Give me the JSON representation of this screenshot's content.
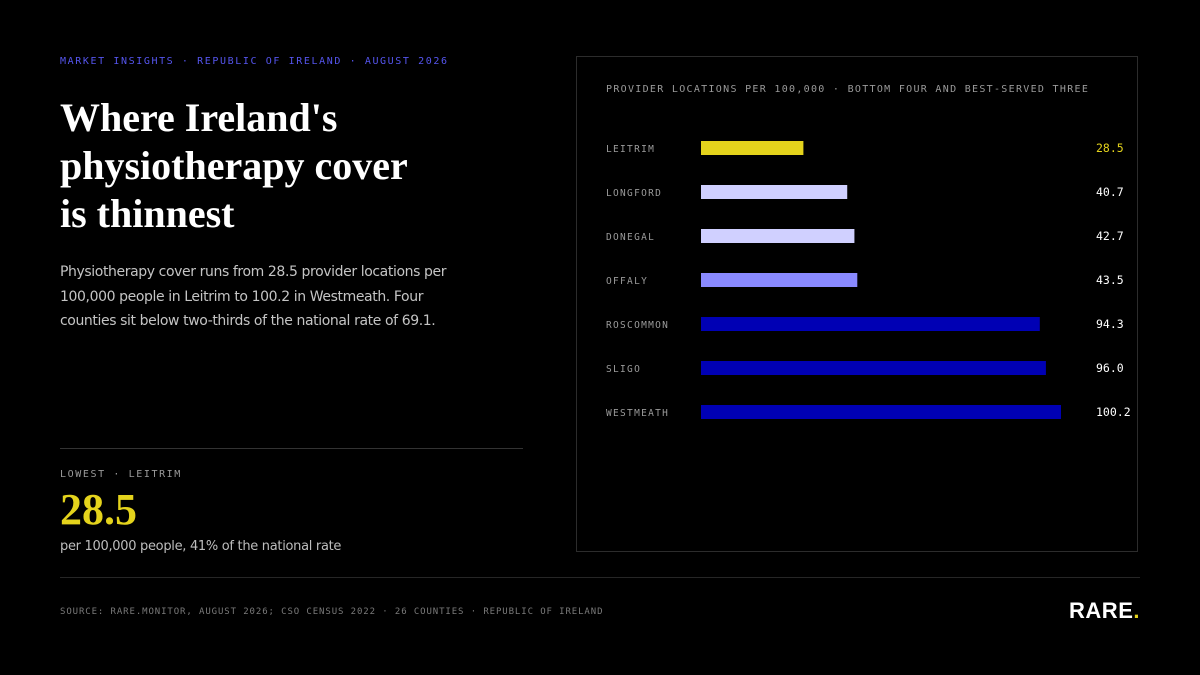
{
  "header": {
    "eyebrow": "MARKET INSIGHTS · REPUBLIC OF IRELAND · AUGUST 2026",
    "headline_lines": [
      "Where Ireland's",
      "physiotherapy cover",
      "is thinnest"
    ],
    "dek": "Physiotherapy cover runs from 28.5 provider locations per 100,000 people in Leitrim to 100.2 in Westmeath. Four counties sit below two-thirds of the national rate of 69.1."
  },
  "stat": {
    "label": "LOWEST · LEITRIM",
    "value": "28.5",
    "caption": "per 100,000 people, 41% of the national rate"
  },
  "chart_data": {
    "type": "bar",
    "orientation": "horizontal",
    "title": "PROVIDER LOCATIONS PER 100,000 · BOTTOM FOUR AND BEST-SERVED THREE",
    "categories": [
      "LEITRIM",
      "LONGFORD",
      "DONEGAL",
      "OFFALY",
      "ROSCOMMON",
      "SLIGO",
      "WESTMEATH"
    ],
    "values": [
      28.5,
      40.7,
      42.7,
      43.5,
      94.3,
      96.0,
      100.2
    ],
    "value_labels": [
      "28.5",
      "40.7",
      "42.7",
      "43.5",
      "94.3",
      "96.0",
      "100.2"
    ],
    "colors": [
      "#e4d31c",
      "#d0d0ff",
      "#d0d0ff",
      "#8a8aff",
      "#0000b4",
      "#0000b4",
      "#0000b4"
    ],
    "highlight_label_color": "#e4d31c",
    "label_color": "#ffffff",
    "xlim": [
      0,
      100.2
    ],
    "grid": false,
    "legend": "none"
  },
  "footer": {
    "source": "SOURCE: RARE.MONITOR, AUGUST 2026; CSO CENSUS 2022 · 26 COUNTIES · REPUBLIC OF IRELAND",
    "logo_text": "RARE",
    "logo_dot": "."
  }
}
